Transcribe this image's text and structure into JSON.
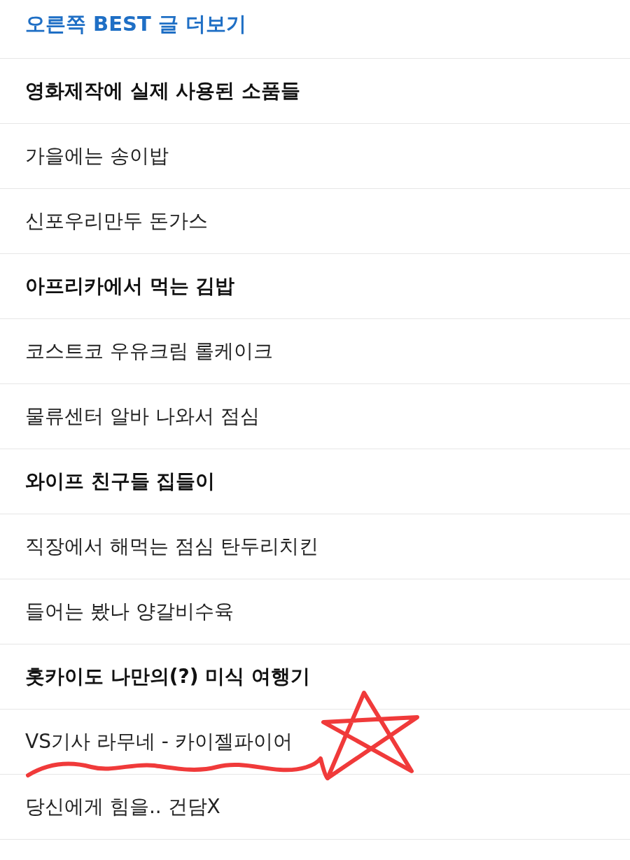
{
  "header": {
    "title": "오른쪽 BEST 글 더보기"
  },
  "items": [
    {
      "title": "영화제작에 실제 사용된 소품들",
      "bold": true
    },
    {
      "title": "가을에는 송이밥",
      "bold": false
    },
    {
      "title": "신포우리만두 돈가스",
      "bold": false
    },
    {
      "title": "아프리카에서 먹는 김밥",
      "bold": true
    },
    {
      "title": "코스트코 우유크림 롤케이크",
      "bold": false
    },
    {
      "title": "물류센터 알바 나와서 점심",
      "bold": false
    },
    {
      "title": "와이프 친구들 집들이",
      "bold": true
    },
    {
      "title": "직장에서 해먹는 점심 탄두리치킨",
      "bold": false
    },
    {
      "title": "들어는 봤나 양갈비수육",
      "bold": false
    },
    {
      "title": "홋카이도 나만의(?) 미식 여행기",
      "bold": true
    },
    {
      "title": "VS기사 라무네 - 카이젤파이어",
      "bold": false
    },
    {
      "title": "당신에게 힘을.. 건담X",
      "bold": false
    }
  ]
}
